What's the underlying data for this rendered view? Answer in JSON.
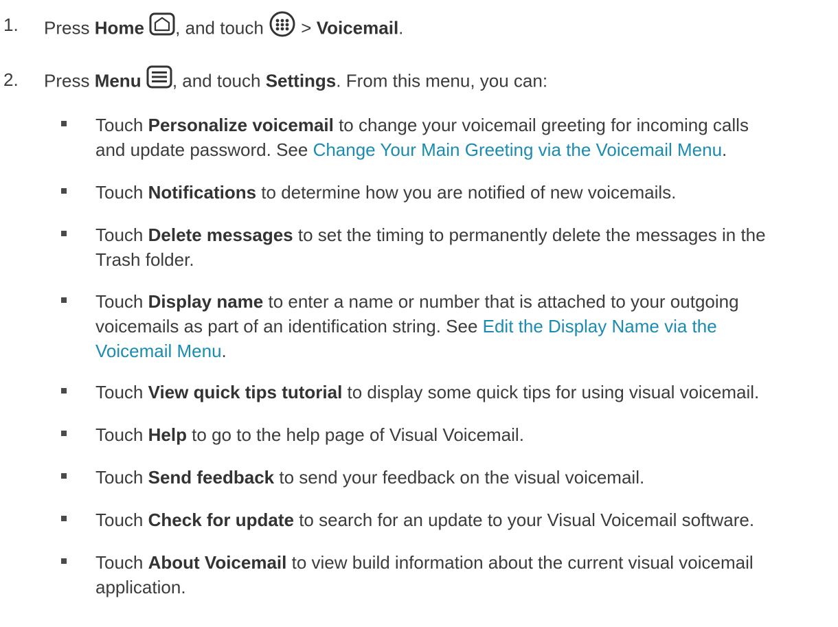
{
  "steps": [
    {
      "number": "1.",
      "prefix": "Press ",
      "bold1": "Home",
      "icon1": "home-icon",
      "middle": ", and touch ",
      "icon2": "apps-icon",
      "sep": " > ",
      "bold2": "Voicemail",
      "suffix": "."
    },
    {
      "number": "2.",
      "prefix": "Press ",
      "bold1": "Menu",
      "icon1": "menu-icon",
      "middle": ", and touch ",
      "bold2": "Settings",
      "suffix": ". From this menu, you can:"
    }
  ],
  "bullets": [
    {
      "lead": "Touch ",
      "bold": "Personalize voicemail",
      "line1": " to change your voicemail greeting for incoming calls",
      "line2": "and update password. See ",
      "link": "Change Your Main Greeting via the Voicemail Menu",
      "end": "."
    },
    {
      "lead": "Touch ",
      "bold": "Notifications",
      "line1": " to determine how you are notified of new voicemails."
    },
    {
      "lead": "Touch ",
      "bold": "Delete messages",
      "line1": " to set the timing to permanently delete the messages in the",
      "line2": "Trash folder."
    },
    {
      "lead": "Touch ",
      "bold": "Display name",
      "line1": " to enter a name or number that is attached to your outgoing",
      "line2": "voicemails as part of an identification string. See ",
      "link_part1": "Edit the Display Name via the",
      "link_part2": "Voicemail Menu",
      "end": "."
    },
    {
      "lead": "Touch ",
      "bold": "View quick tips tutorial",
      "line1": " to display some quick tips for using visual voicemail."
    },
    {
      "lead": "Touch ",
      "bold": "Help",
      "line1": " to go to the help page of Visual Voicemail."
    },
    {
      "lead": "Touch ",
      "bold": "Send feedback",
      "line1": " to send your feedback on the visual voicemail."
    },
    {
      "lead": "Touch ",
      "bold": "Check for update",
      "line1": " to search for an update to your Visual Voicemail software."
    },
    {
      "lead": "Touch ",
      "bold": "About Voicemail",
      "line1": " to view build information about the current visual voicemail",
      "line2": "application."
    }
  ]
}
